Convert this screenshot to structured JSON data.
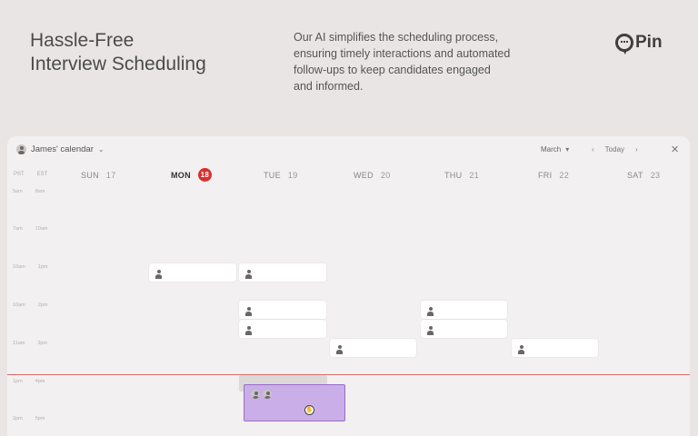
{
  "hero": {
    "title_line1": "Hassle-Free",
    "title_line2": "Interview Scheduling",
    "description": "Our AI simplifies the scheduling process, ensuring timely interactions and automated follow-ups to keep candidates engaged and informed.",
    "brand": "Pin"
  },
  "calendar": {
    "owner": "James' calendar",
    "month": "March",
    "today_label": "Today",
    "timezones": [
      "PST",
      "EST"
    ],
    "days": [
      {
        "name": "SUN",
        "num": "17"
      },
      {
        "name": "MON",
        "num": "18"
      },
      {
        "name": "TUE",
        "num": "19"
      },
      {
        "name": "WED",
        "num": "20"
      },
      {
        "name": "THU",
        "num": "21"
      },
      {
        "name": "FRI",
        "num": "22"
      },
      {
        "name": "SAT",
        "num": "23"
      }
    ],
    "times": [
      [
        "5am",
        "8am"
      ],
      [
        "7am",
        "10am"
      ],
      [
        "10am",
        "1pm"
      ],
      [
        "10am",
        "2pm"
      ],
      [
        "11am",
        "3pm"
      ],
      [
        "1pm",
        "4pm"
      ],
      [
        "2pm",
        "5pm"
      ]
    ]
  },
  "colors": {
    "today_badge": "#d8302f",
    "now_line": "#d86a6a",
    "drag_event_fill": "#c9aee7",
    "drag_event_border": "#9a6cc9"
  },
  "icons": {
    "chevron": "chevron-down-icon",
    "prev": "chevron-left-icon",
    "next": "chevron-right-icon",
    "close": "close-icon",
    "grab": "grab-hand-icon",
    "logo": "pin-logo-icon"
  }
}
